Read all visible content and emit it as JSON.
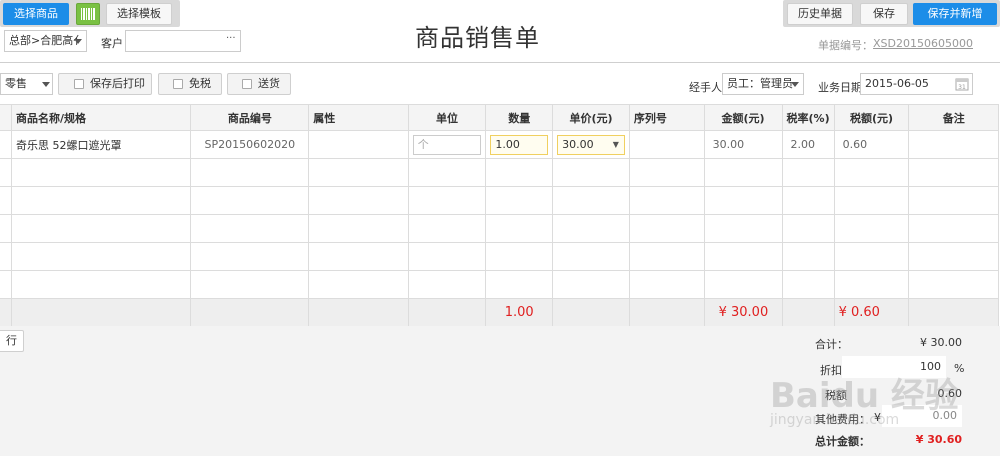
{
  "toolbar_left": {
    "select_goods": "选择商品",
    "select_template": "选择模板"
  },
  "toolbar_right": {
    "history": "历史单据",
    "save": "保存",
    "save_new": "保存并新增"
  },
  "title": "商品销售单",
  "org_select": "总部>合肥高亻",
  "customer_label": "客户",
  "customer_value": "",
  "customer_more": "···",
  "doc_no_label": "单据编号：",
  "doc_no_value": "XSD20150605000",
  "sale_type": "零售",
  "options": {
    "print_after_save": "保存后打印",
    "tax_free": "免税",
    "delivery": "送货"
  },
  "handler_label": "经手人",
  "handler_value": "员工：管理员",
  "biz_date_label": "业务日期",
  "biz_date_value": "2015-06-05",
  "table": {
    "headers": [
      "商品名称/规格",
      "商品编号",
      "属性",
      "单位",
      "数量",
      "单价(元)",
      "序列号",
      "金额(元)",
      "税率(%)",
      "税额(元)",
      "备注"
    ],
    "rows": [
      {
        "name": "奇乐思 52螺口遮光罩",
        "code": "SP20150602020",
        "attr": "",
        "unit_placeholder": "个",
        "qty": "1.00",
        "price": "30.00",
        "serial": "",
        "amount": "30.00",
        "tax_rate": "2.00",
        "tax_amount": "0.60",
        "remark": ""
      }
    ],
    "totals": {
      "qty": "1.00",
      "amount": "¥ 30.00",
      "tax_amount": "¥ 0.60"
    }
  },
  "add_row_fragment": "行",
  "summary": {
    "subtotal_label": "合计：",
    "subtotal_value": "¥ 30.00",
    "discount_label": "折扣率",
    "discount_value": "100",
    "discount_unit": "%",
    "tax_label": "税额",
    "tax_value": "0.60",
    "other_label": "其他费用：",
    "other_currency": "¥",
    "other_value": "0.00",
    "total_label": "总计金额：",
    "total_value": "¥ 30.60"
  },
  "watermark": {
    "brand": "Baidu 经验",
    "url": "jingyan.baidu.com"
  },
  "colors": {
    "primary": "#1c8de8",
    "total_red": "#e02020"
  }
}
